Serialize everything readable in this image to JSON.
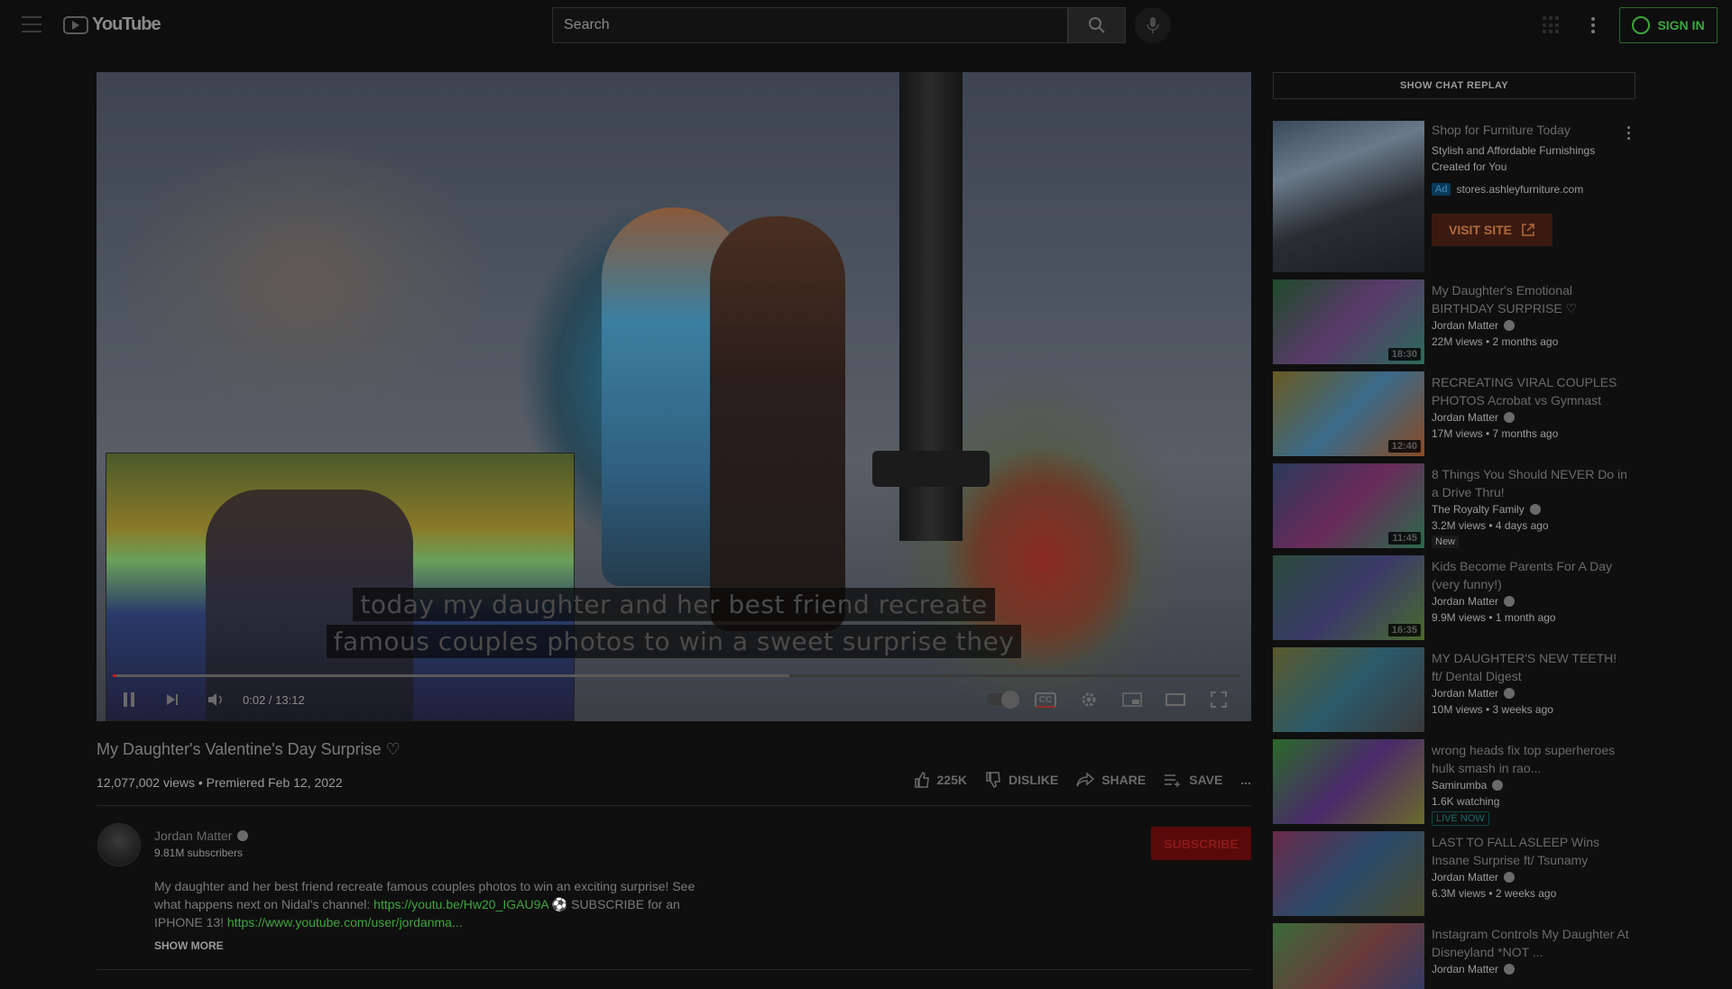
{
  "masthead": {
    "logo_text": "YouTube",
    "search_placeholder": "Search",
    "signin_label": "SIGN IN"
  },
  "player": {
    "captions": [
      "today my daughter and her best friend recreate",
      "famous couples photos to win a sweet surprise they"
    ],
    "time": "0:02 / 13:12",
    "progress_fraction": 0.003,
    "buffer_fraction": 0.6,
    "cc_label": "CC"
  },
  "video": {
    "title": "My Daughter's Valentine's Day Surprise ♡",
    "meta": "12,077,002 views • Premiered Feb 12, 2022",
    "actions": {
      "like": "225K",
      "dislike": "DISLIKE",
      "share": "SHARE",
      "save": "SAVE",
      "more": "..."
    }
  },
  "channel": {
    "name": "Jordan Matter",
    "subscribers": "9.81M subscribers",
    "subscribe_label": "SUBSCRIBE",
    "description_pre": "My daughter and her best friend recreate famous couples photos to win an exciting surprise! See what happens next on Nidal's channel: ",
    "description_link1": "https://youtu.be/Hw20_IGAU9A",
    "description_mid": " ⚽ SUBSCRIBE for an IPHONE 13! ",
    "description_link2": "https://www.youtube.com/user/jordanma...",
    "show_more": "SHOW MORE"
  },
  "sidebar": {
    "chat_replay": "SHOW CHAT REPLAY",
    "ad": {
      "title": "Shop for Furniture Today",
      "description": "Stylish and Affordable Furnishings Created for You",
      "badge": "Ad",
      "domain": "stores.ashleyfurniture.com",
      "cta": "VISIT SITE"
    },
    "recommendations": [
      {
        "title": "My Daughter's Emotional BIRTHDAY SURPRISE ♡",
        "channel": "Jordan Matter",
        "views": "22M views • 2 months ago",
        "duration": "18:30",
        "badge": ""
      },
      {
        "title": "RECREATING VIRAL COUPLES PHOTOS Acrobat vs Gymnast",
        "channel": "Jordan Matter",
        "views": "17M views • 7 months ago",
        "duration": "12:40",
        "badge": ""
      },
      {
        "title": "8 Things You Should NEVER Do in a Drive Thru!",
        "channel": "The Royalty Family",
        "views": "3.2M views • 4 days ago",
        "duration": "11:45",
        "badge": "New"
      },
      {
        "title": "Kids Become Parents For A Day (very funny!)",
        "channel": "Jordan Matter",
        "views": "9.9M views • 1 month ago",
        "duration": "16:35",
        "badge": ""
      },
      {
        "title": "MY DAUGHTER'S NEW TEETH! ft/ Dental Digest",
        "channel": "Jordan Matter",
        "views": "10M views • 3 weeks ago",
        "duration": "",
        "badge": ""
      },
      {
        "title": "wrong heads fix top superheroes hulk smash in rao...",
        "channel": "Samirumba",
        "views": "1.6K watching",
        "duration": "",
        "badge": "LIVE NOW"
      },
      {
        "title": "LAST TO FALL ASLEEP Wins Insane Surprise ft/ Tsunamy",
        "channel": "Jordan Matter",
        "views": "6.3M views • 2 weeks ago",
        "duration": "",
        "badge": ""
      },
      {
        "title": "Instagram Controls My Daughter At Disneyland *NOT ...",
        "channel": "Jordan Matter",
        "views": "",
        "duration": "",
        "badge": ""
      }
    ]
  }
}
